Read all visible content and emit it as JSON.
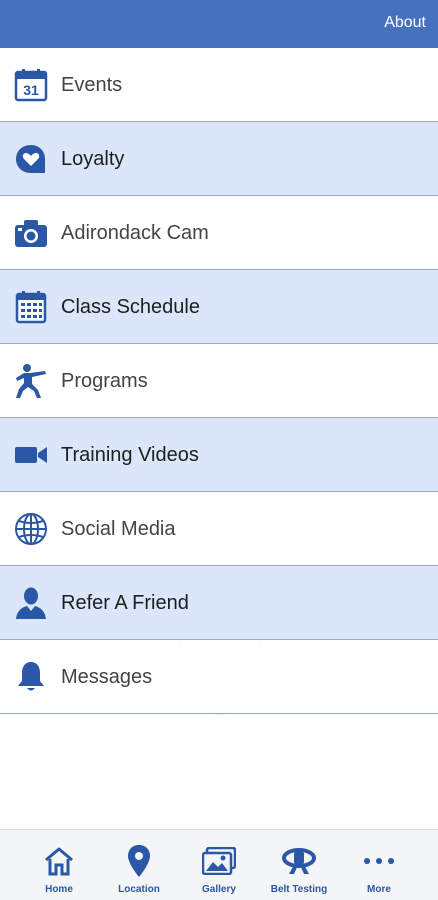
{
  "header": {
    "about_label": "About"
  },
  "menu": {
    "items": [
      {
        "label": "Events",
        "icon": "calendar-31-icon",
        "calendar_day": "31"
      },
      {
        "label": "Loyalty",
        "icon": "heart-bubble-icon"
      },
      {
        "label": "Adirondack Cam",
        "icon": "camera-icon"
      },
      {
        "label": "Class Schedule",
        "icon": "calendar-grid-icon"
      },
      {
        "label": "Programs",
        "icon": "martial-artist-icon"
      },
      {
        "label": "Training Videos",
        "icon": "video-camera-icon"
      },
      {
        "label": "Social Media",
        "icon": "globe-icon"
      },
      {
        "label": "Refer A Friend",
        "icon": "person-icon"
      },
      {
        "label": "Messages",
        "icon": "bell-icon"
      }
    ]
  },
  "tabbar": {
    "tabs": [
      {
        "label": "Home",
        "icon": "home-icon"
      },
      {
        "label": "Location",
        "icon": "location-pin-icon"
      },
      {
        "label": "Gallery",
        "icon": "gallery-icon"
      },
      {
        "label": "Belt Testing",
        "icon": "belt-icon"
      },
      {
        "label": "More",
        "icon": "more-dots-icon"
      }
    ]
  },
  "colors": {
    "header_bg": "#4672bd",
    "accent": "#2a57a6",
    "row_alt_bg": "#dbe6fb",
    "tab_bar_bg": "#f4f5f7"
  }
}
